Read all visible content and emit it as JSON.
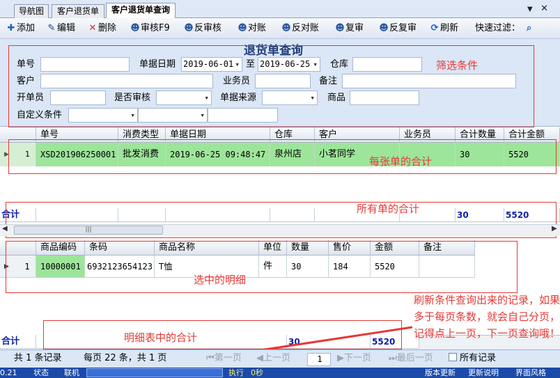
{
  "tabs": [
    {
      "label": "导航图",
      "active": false
    },
    {
      "label": "客户退货单",
      "active": false
    },
    {
      "label": "客户退货单查询",
      "active": true
    }
  ],
  "window": {
    "dropdown_symbol": "▼",
    "close_symbol": "✕"
  },
  "toolbar": {
    "add": "添加",
    "edit": "编辑",
    "delete": "删除",
    "audit": "审核F9",
    "unaudit": "反审核",
    "reconcile": "对账",
    "unreconcile": "反对账",
    "recheck": "复审",
    "unrecheck": "反复审",
    "refresh": "刷新",
    "quick_filter": "快速过滤："
  },
  "filter": {
    "title": "退货单查询",
    "doc_no_label": "单号",
    "doc_date_label": "单据日期",
    "date_from": "2019-06-01",
    "to_label": "至",
    "date_to": "2019-06-25",
    "warehouse_label": "仓库",
    "customer_label": "客户",
    "salesman_label": "业务员",
    "remark_label": "备注",
    "maker_label": "开单员",
    "audited_label": "是否审核",
    "source_label": "单据来源",
    "goods_label": "商品",
    "custom_label": "自定义条件"
  },
  "annotations": {
    "filter": "筛选条件",
    "per_doc_total": "每张单的合计",
    "all_total": "所有单的合计",
    "selected_detail": "选中的明细",
    "detail_total": "明细表中的合计",
    "refresh_note": "刷新条件查询出来的记录，如果多于每页条数，就会自己分页，记得点上一页，下一页查询哦！"
  },
  "main_grid": {
    "headers": [
      "单号",
      "消费类型",
      "单据日期",
      "仓库",
      "客户",
      "业务员",
      "合计数量",
      "合计金额"
    ],
    "rows": [
      {
        "index": "1",
        "doc_no": "XSD201906250001",
        "type": "批发消费",
        "date": "2019-06-25 09:48:47",
        "warehouse": "泉州店",
        "customer": "小茗同学",
        "salesman": "",
        "qty": "30",
        "amount": "5520"
      }
    ],
    "total_label": "合计",
    "total_qty": "30",
    "total_amount": "5520"
  },
  "detail_grid": {
    "headers": [
      "商品编码",
      "条码",
      "商品名称",
      "单位",
      "数量",
      "售价",
      "金额",
      "备注"
    ],
    "rows": [
      {
        "index": "1",
        "code": "10000001",
        "barcode": "6932123654123",
        "name": "T恤",
        "unit": "件",
        "qty": "30",
        "price": "184",
        "amount": "5520",
        "remark": ""
      }
    ],
    "total_label": "合计",
    "total_qty": "30",
    "total_amount": "5520"
  },
  "pager": {
    "records": "共 1 条记录",
    "per_page": "每页 22 条，共 1 页",
    "first": "第一页",
    "prev": "上一页",
    "page_value": "1",
    "next": "下一页",
    "last": "最后一页",
    "all": "所有记录"
  },
  "status": {
    "left": "0.21",
    "s1": "状态",
    "s2": "联机",
    "s3": "执行",
    "s4": "0秒",
    "s5": "版本更新",
    "s6": "更新说明",
    "s7": "界面风格"
  },
  "colors": {
    "accent_red": "#e53935",
    "row_green": "#9de59a",
    "total_blue": "#0b1fa8"
  }
}
